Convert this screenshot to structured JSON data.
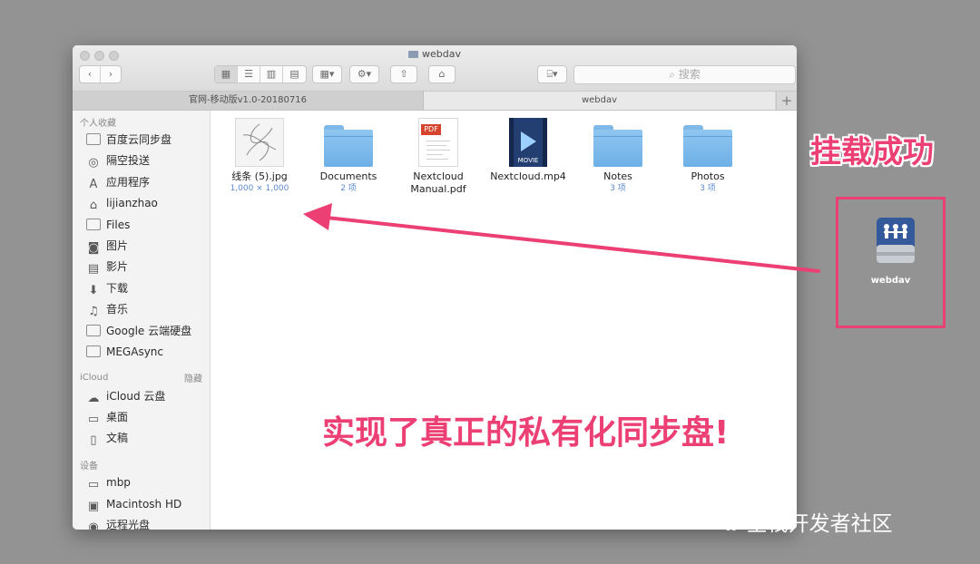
{
  "window": {
    "title": "webdav",
    "search_placeholder": "搜索"
  },
  "tabs": [
    {
      "label": "官网-移动版v1.0-20180716"
    },
    {
      "label": "webdav"
    }
  ],
  "sidebar": {
    "favorites_header": "个人收藏",
    "favorites": [
      {
        "label": "百度云同步盘",
        "icon": "folder-icon"
      },
      {
        "label": "隔空投送",
        "icon": "airdrop-icon"
      },
      {
        "label": "应用程序",
        "icon": "applications-icon"
      },
      {
        "label": "lijianzhao",
        "icon": "home-icon"
      },
      {
        "label": "Files",
        "icon": "folder-icon"
      },
      {
        "label": "图片",
        "icon": "camera-icon"
      },
      {
        "label": "影片",
        "icon": "film-icon"
      },
      {
        "label": "下载",
        "icon": "download-icon"
      },
      {
        "label": "音乐",
        "icon": "music-icon"
      },
      {
        "label": "Google 云端硬盘",
        "icon": "folder-icon"
      },
      {
        "label": "MEGAsync",
        "icon": "folder-icon"
      }
    ],
    "icloud_header": "iCloud",
    "icloud_hide": "隐藏",
    "icloud": [
      {
        "label": "iCloud 云盘",
        "icon": "cloud-icon"
      },
      {
        "label": "桌面",
        "icon": "desktop-icon"
      },
      {
        "label": "文稿",
        "icon": "document-icon"
      }
    ],
    "devices_header": "设备",
    "devices": [
      {
        "label": "mbp",
        "icon": "laptop-icon"
      },
      {
        "label": "Macintosh HD",
        "icon": "harddisk-icon"
      },
      {
        "label": "远程光盘",
        "icon": "disc-icon"
      }
    ]
  },
  "files": [
    {
      "name": "线条 (5).jpg",
      "sub": "1,000 × 1,000",
      "icon": "image-thumbnail-icon"
    },
    {
      "name": "Documents",
      "sub": "2 项",
      "icon": "folder-icon"
    },
    {
      "name": "Nextcloud Manual.pdf",
      "sub": "",
      "icon": "pdf-icon"
    },
    {
      "name": "Nextcloud.mp4",
      "sub": "",
      "icon": "movie-icon",
      "badge": "MOVIE"
    },
    {
      "name": "Notes",
      "sub": "3 项",
      "icon": "folder-icon"
    },
    {
      "name": "Photos",
      "sub": "3 项",
      "icon": "folder-icon"
    }
  ],
  "annotations": {
    "mount_success": "挂载成功",
    "private_sync": "实现了真正的私有化同步盘!",
    "accent_color": "#ec3f74"
  },
  "desktop": {
    "drive_label": "webdav"
  },
  "watermark": "全栈开发者社区"
}
